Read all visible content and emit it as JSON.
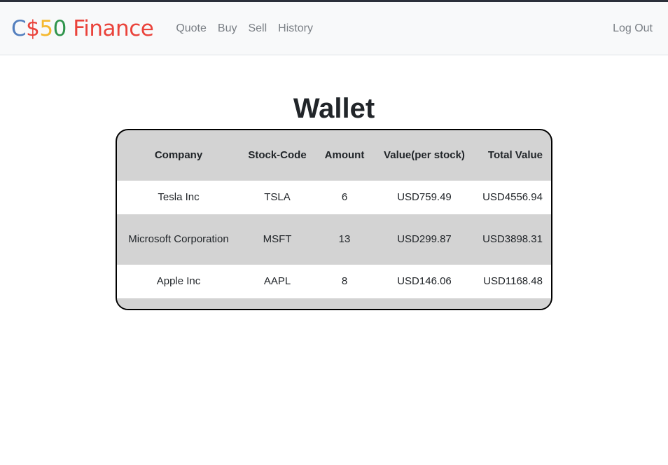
{
  "brand": {
    "c": "C",
    "dollar": "$",
    "five": "5",
    "zero": "0",
    "finance": " Finance"
  },
  "nav": {
    "links": [
      "Quote",
      "Buy",
      "Sell",
      "History"
    ],
    "logout": "Log Out"
  },
  "main": {
    "title": "Wallet"
  },
  "table": {
    "headers": [
      "Company",
      "Stock-Code",
      "Amount",
      "Value(per stock)",
      "Total Value"
    ],
    "rows": [
      {
        "company": "Tesla Inc",
        "code": "TSLA",
        "amount": "6",
        "value": "USD759.49",
        "total": "USD4556.94"
      },
      {
        "company": "Microsoft Corporation",
        "code": "MSFT",
        "amount": "13",
        "value": "USD299.87",
        "total": "USD3898.31"
      },
      {
        "company": "Apple Inc",
        "code": "AAPL",
        "amount": "8",
        "value": "USD146.06",
        "total": "USD1168.48"
      }
    ]
  },
  "colors": {
    "brand_blue": "#537fbe",
    "brand_red": "#ea433b",
    "brand_yellow": "#f5b82e",
    "brand_green": "#2e944b",
    "row_gray": "#d3d3d3",
    "navbar_bg": "#f8f9fa"
  }
}
